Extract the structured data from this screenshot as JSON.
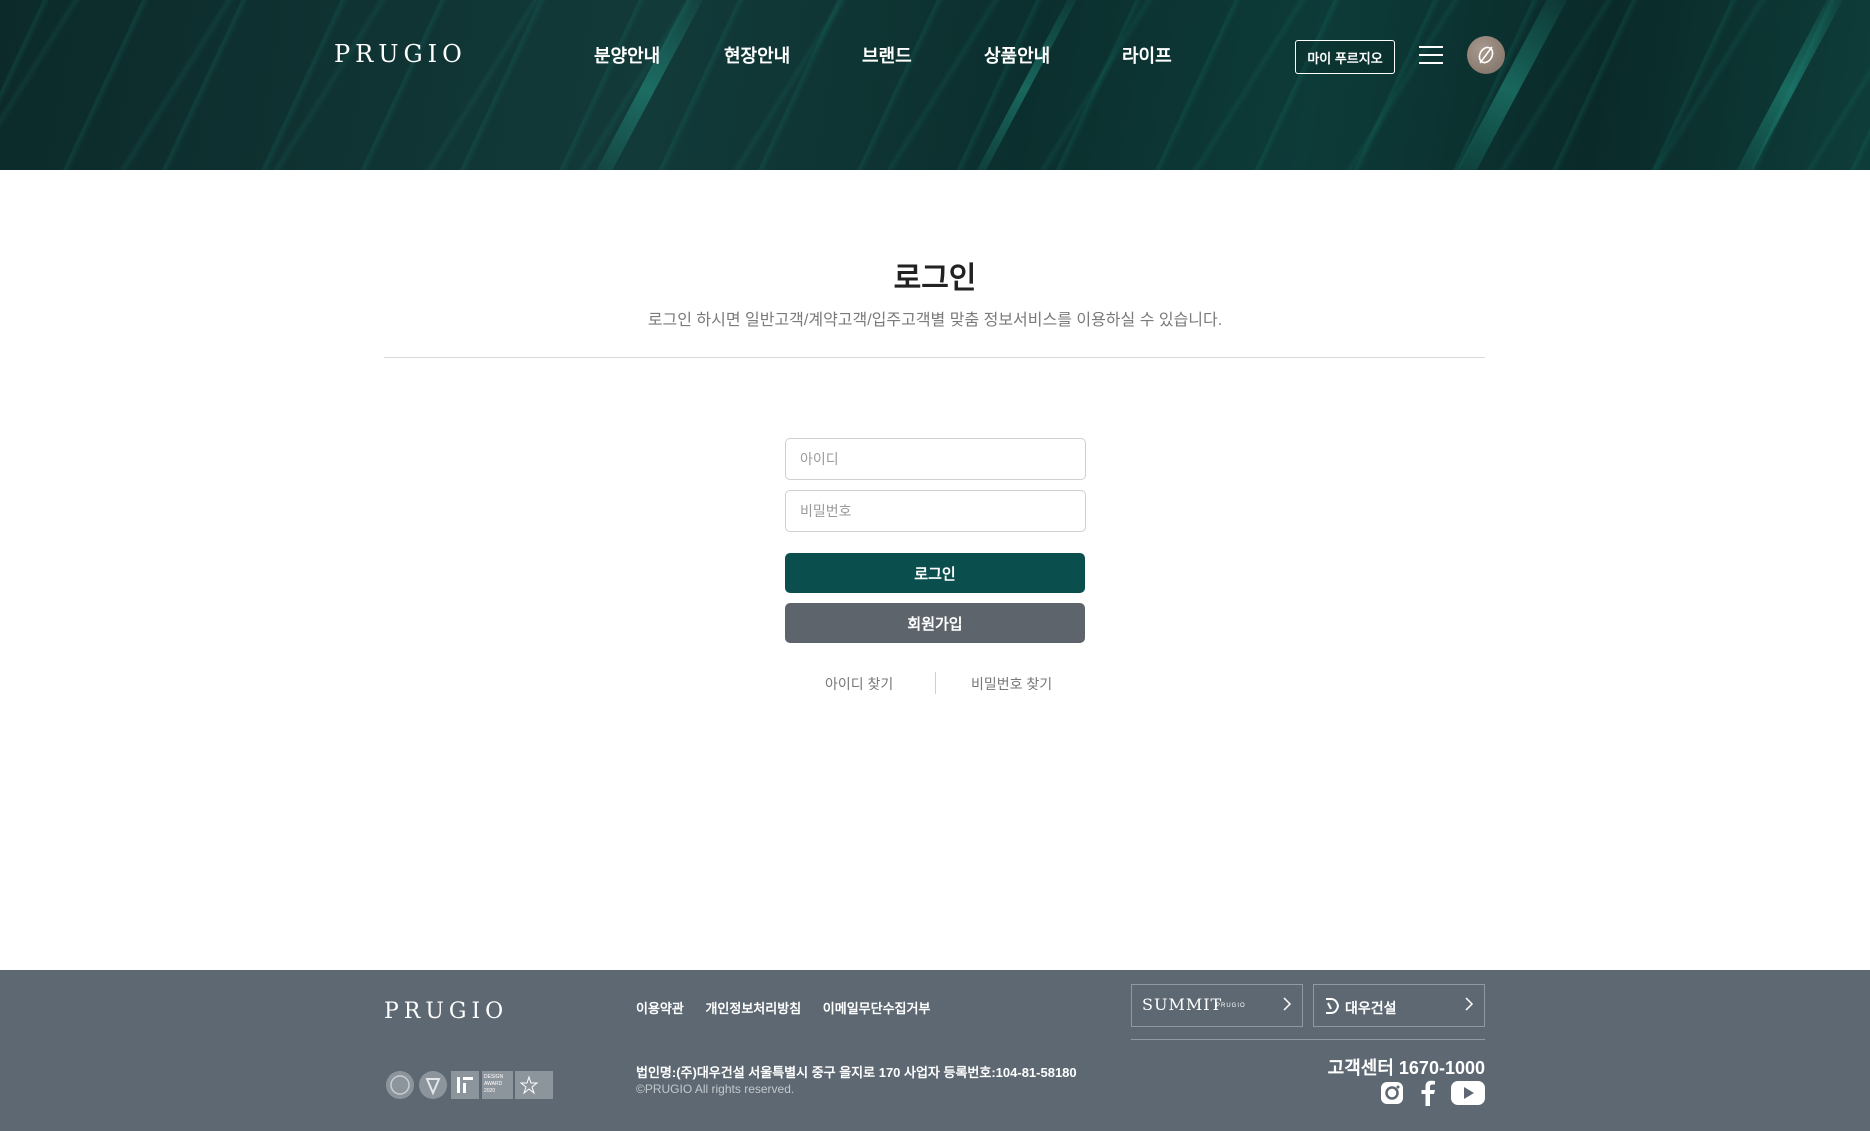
{
  "header": {
    "logo": "PRUGIO",
    "nav": [
      "분양안내",
      "현장안내",
      "브랜드",
      "상품안내",
      "라이프"
    ],
    "my_button": "마이 푸르지오",
    "icons": {
      "menu": "hamburger-menu-icon",
      "emblem": "prugio-emblem-icon"
    }
  },
  "main": {
    "title": "로그인",
    "description": "로그인 하시면 일반고객/계약고객/입주고객별 맞춤 정보서비스를 이용하실 수 있습니다.",
    "id_placeholder": "아이디",
    "pw_placeholder": "비밀번호",
    "login_button": "로그인",
    "join_button": "회원가입",
    "find_id": "아이디 찾기",
    "find_pw": "비밀번호 찾기"
  },
  "footer": {
    "logo": "PRUGIO",
    "links": [
      "이용약관",
      "개인정보처리방침",
      "이메일무단수집거부"
    ],
    "summit_label": "SUMMIT",
    "summit_sub": "PRUGIO",
    "daewoo_label": "대우건설",
    "address": "법인명:(주)대우건설 서울특별시 중구 을지로 170 사업자 등록번호:104-81-58180",
    "copyright": "©PRUGIO All rights reserved.",
    "customer_center": "고객센터 1670-1000",
    "award_text": "DESIGN AWARD 2020",
    "social_icons": [
      "instagram-icon",
      "facebook-icon",
      "youtube-icon"
    ]
  },
  "colors": {
    "header_bg": "#0c2f2e",
    "login_button": "#0a4f4d",
    "join_button": "#5d646c",
    "footer_bg": "#5d6872"
  }
}
